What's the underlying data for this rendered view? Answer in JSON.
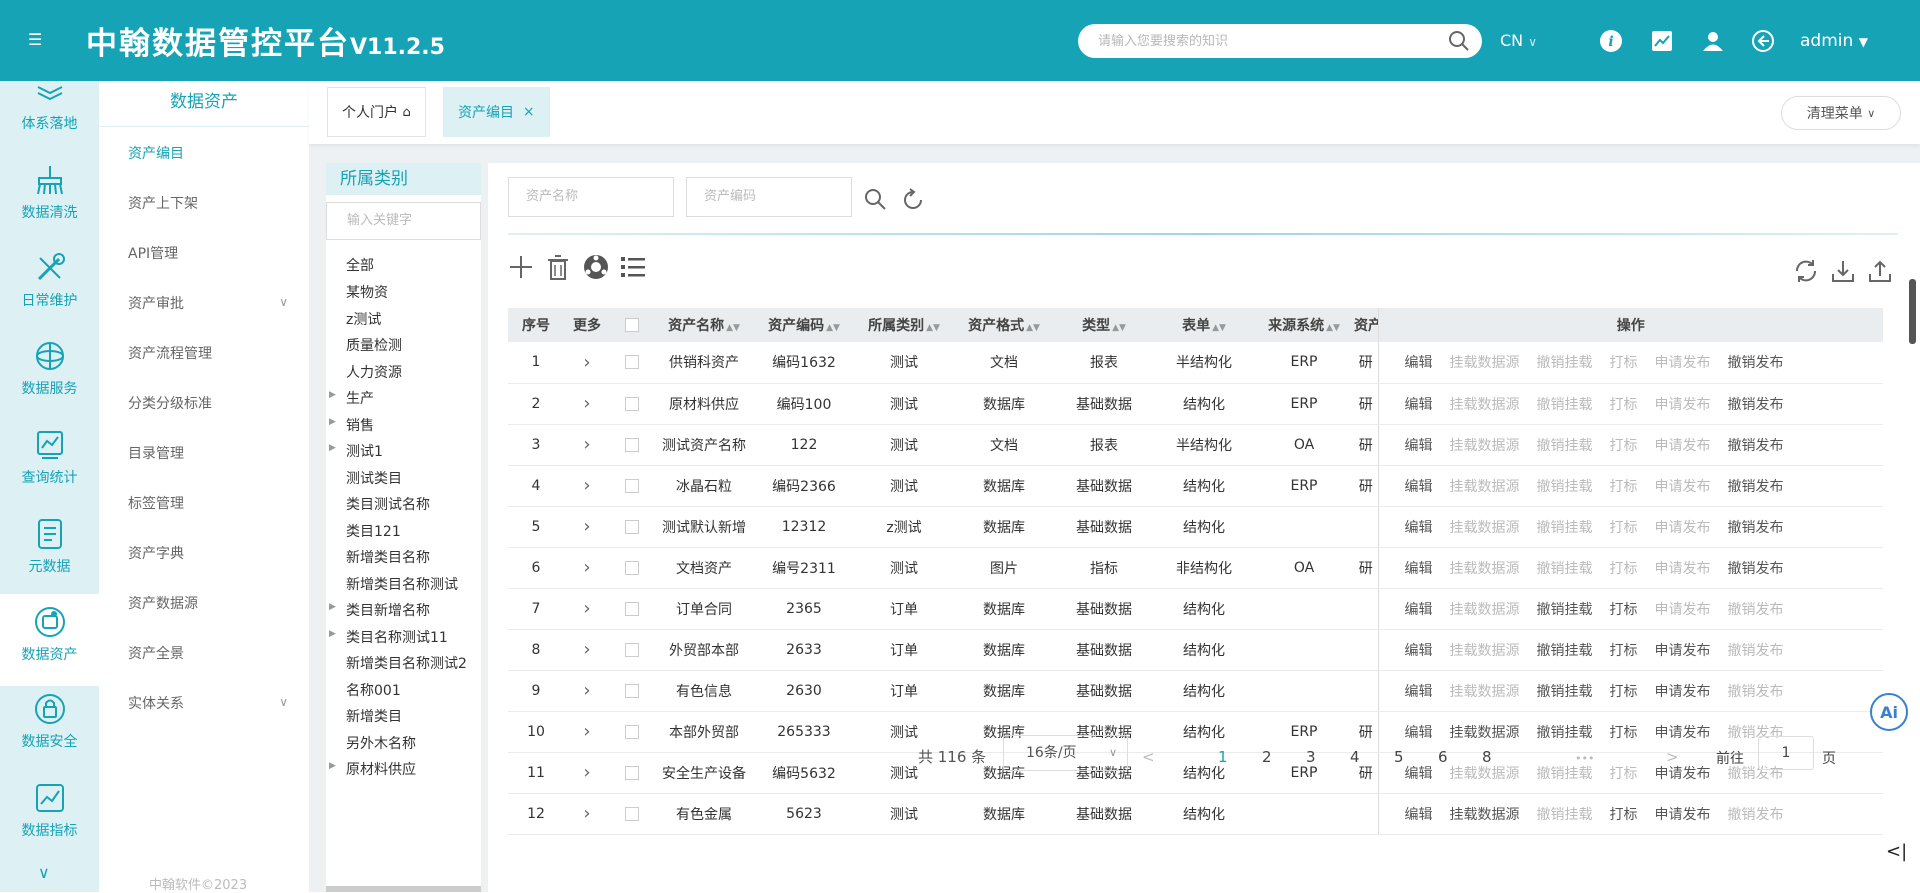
{
  "header": {
    "menu_icon": "hamburger-icon",
    "title": "中翰数据管控平台",
    "version": "V11.2.5",
    "search_placeholder": "请输入您要搜索的知识",
    "lang": "CN",
    "user": "admin",
    "icons": [
      "search-icon",
      "info-icon",
      "chart-icon",
      "user-icon",
      "logout-icon"
    ]
  },
  "iconbar": [
    {
      "label": "体系落地",
      "icon": "layers-icon"
    },
    {
      "label": "数据清洗",
      "icon": "clean-icon"
    },
    {
      "label": "日常维护",
      "icon": "tools-icon"
    },
    {
      "label": "数据服务",
      "icon": "globe-icon"
    },
    {
      "label": "查询统计",
      "icon": "stats-icon"
    },
    {
      "label": "元数据",
      "icon": "document-icon"
    },
    {
      "label": "数据资产",
      "icon": "asset-icon"
    },
    {
      "label": "数据安全",
      "icon": "lock-icon"
    },
    {
      "label": "数据指标",
      "icon": "trend-icon"
    }
  ],
  "sidebar": {
    "title": "数据资产",
    "items": [
      "资产编目",
      "资产上下架",
      "API管理",
      "资产审批",
      "资产流程管理",
      "分类分级标准",
      "目录管理",
      "标签管理",
      "资产字典",
      "资产数据源",
      "资产全景",
      "实体关系"
    ],
    "footer": "中翰软件©2023"
  },
  "tabs": {
    "home": "个人门户",
    "active": "资产编目",
    "clear": "清理菜单"
  },
  "tree": {
    "title": "所属类别",
    "placeholder": "输入关键字",
    "nodes": [
      "全部",
      "某物资",
      "z测试",
      "质量检测",
      "人力资源",
      "生产",
      "销售",
      "测试1",
      "测试类目",
      "类目测试名称",
      "类目121",
      "新增类目名称",
      "新增类目名称测试",
      "类目新增名称",
      "类目名称测试11",
      "新增类目名称测试2",
      "名称001",
      "新增类目",
      "另外木名称",
      "原材料供应"
    ]
  },
  "filters": {
    "name_placeholder": "资产名称",
    "code_placeholder": "资产编码"
  },
  "table": {
    "headers": [
      "序号",
      "更多",
      "",
      "资产名称",
      "资产编码",
      "所属类别",
      "资产格式",
      "类型",
      "表单",
      "来源系统",
      "资产",
      "操作"
    ],
    "ops": [
      "编辑",
      "挂载数据源",
      "撤销挂载",
      "打标",
      "申请发布",
      "撤销发布"
    ],
    "rows": [
      {
        "no": "1",
        "name": "供销科资产",
        "code": "编码1632",
        "cat": "测试",
        "fmt": "文档",
        "type": "报表",
        "form": "半结构化",
        "src": "ERP",
        "extra": "研"
      },
      {
        "no": "2",
        "name": "原材料供应",
        "code": "编码100",
        "cat": "测试",
        "fmt": "数据库",
        "type": "基础数据",
        "form": "结构化",
        "src": "ERP",
        "extra": "研"
      },
      {
        "no": "3",
        "name": "测试资产名称",
        "code": "122",
        "cat": "测试",
        "fmt": "文档",
        "type": "报表",
        "form": "半结构化",
        "src": "OA",
        "extra": "研"
      },
      {
        "no": "4",
        "name": "冰晶石粒",
        "code": "编码2366",
        "cat": "测试",
        "fmt": "数据库",
        "type": "基础数据",
        "form": "结构化",
        "src": "ERP",
        "extra": "研"
      },
      {
        "no": "5",
        "name": "测试默认新增",
        "code": "12312",
        "cat": "z测试",
        "fmt": "数据库",
        "type": "基础数据",
        "form": "结构化",
        "src": "",
        "extra": ""
      },
      {
        "no": "6",
        "name": "文档资产",
        "code": "编号2311",
        "cat": "测试",
        "fmt": "图片",
        "type": "指标",
        "form": "非结构化",
        "src": "OA",
        "extra": "研"
      },
      {
        "no": "7",
        "name": "订单合同",
        "code": "2365",
        "cat": "订单",
        "fmt": "数据库",
        "type": "基础数据",
        "form": "结构化",
        "src": "",
        "extra": ""
      },
      {
        "no": "8",
        "name": "外贸部本部",
        "code": "2633",
        "cat": "订单",
        "fmt": "数据库",
        "type": "基础数据",
        "form": "结构化",
        "src": "",
        "extra": ""
      },
      {
        "no": "9",
        "name": "有色信息",
        "code": "2630",
        "cat": "订单",
        "fmt": "数据库",
        "type": "基础数据",
        "form": "结构化",
        "src": "",
        "extra": ""
      },
      {
        "no": "10",
        "name": "本部外贸部",
        "code": "265333",
        "cat": "测试",
        "fmt": "数据库",
        "type": "基础数据",
        "form": "结构化",
        "src": "ERP",
        "extra": "研"
      },
      {
        "no": "11",
        "name": "安全生产设备",
        "code": "编码5632",
        "cat": "测试",
        "fmt": "数据库",
        "type": "基础数据",
        "form": "结构化",
        "src": "ERP",
        "extra": "研"
      },
      {
        "no": "12",
        "name": "有色金属",
        "code": "5623",
        "cat": "测试",
        "fmt": "数据库",
        "type": "基础数据",
        "form": "结构化",
        "src": "",
        "extra": ""
      }
    ],
    "op_enabled": [
      [
        1,
        0,
        0,
        0,
        0,
        1
      ],
      [
        1,
        0,
        0,
        0,
        0,
        1
      ],
      [
        1,
        0,
        0,
        0,
        0,
        1
      ],
      [
        1,
        0,
        0,
        0,
        0,
        1
      ],
      [
        1,
        0,
        0,
        0,
        0,
        1
      ],
      [
        1,
        0,
        0,
        0,
        0,
        1
      ],
      [
        1,
        0,
        1,
        1,
        0,
        0
      ],
      [
        1,
        0,
        1,
        1,
        1,
        0
      ],
      [
        1,
        0,
        1,
        1,
        1,
        0
      ],
      [
        1,
        1,
        1,
        1,
        1,
        0
      ],
      [
        1,
        0,
        0,
        0,
        1,
        0
      ],
      [
        1,
        1,
        0,
        1,
        1,
        0
      ]
    ]
  },
  "pagination": {
    "total": "共 116 条",
    "per_page": "16条/页",
    "pages": [
      "1",
      "2",
      "3",
      "4",
      "5",
      "6",
      "8"
    ],
    "ellipsis": "•••",
    "goto": "前往",
    "goto_value": "1",
    "page_unit": "页",
    "current": "1"
  },
  "ai_label": "Ai",
  "colors": {
    "accent": "#16a3b6",
    "light": "#ddf1f4"
  }
}
